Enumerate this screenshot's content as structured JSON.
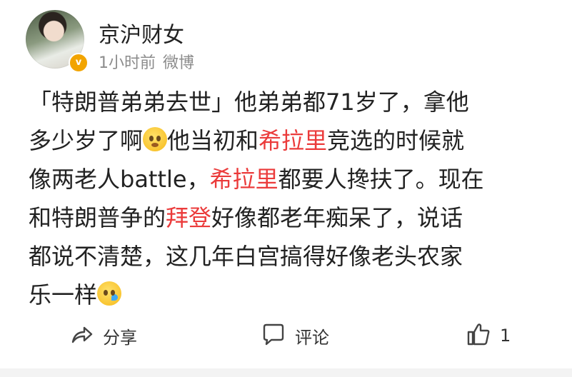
{
  "post": {
    "author": "京沪财女",
    "badge": "v",
    "time": "1小时前",
    "source": "微博",
    "text": {
      "l1": "「特朗普弟弟去世」他弟弟都71岁了，拿他",
      "l2a": "多少岁了啊",
      "l2b": "他当初和",
      "l2c": "希拉里",
      "l2d": "竞选的时候就",
      "l3a": "像两老人battle，",
      "l3b": "希拉里",
      "l3c": "都要人搀扶了。现在",
      "l4a": "和特朗普争的",
      "l4b": "拜登",
      "l4c": "好像都老年痴呆了，说话",
      "l5": "都说不清楚，这几年白宫搞得好像老头农家",
      "l6": "乐一样"
    },
    "emojis": [
      "confused-emoji",
      "sleepy-emoji"
    ]
  },
  "actions": {
    "share_label": "分享",
    "comment_label": "评论",
    "like_count": "1"
  },
  "colors": {
    "highlight": "#eb3b3b",
    "meta": "#8c8c8c",
    "badge": "#f2a400"
  }
}
